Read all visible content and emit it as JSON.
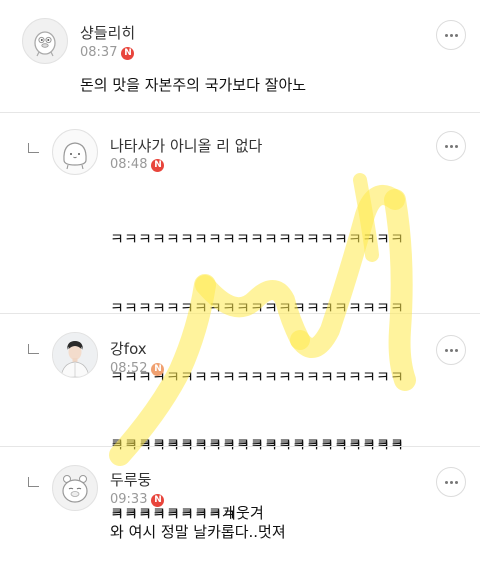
{
  "comments": [
    {
      "author": "샹들리히",
      "time": "08:37",
      "badge": "N",
      "badge_style": "red",
      "avatar_icon": "duck-character-icon",
      "is_reply": false,
      "text": "돈의 맛을 자본주의 국가보다 잘아노"
    },
    {
      "author": "나타샤가 아니올 리 없다",
      "time": "08:48",
      "badge": "N",
      "badge_style": "red",
      "avatar_icon": "blob-character-icon",
      "is_reply": true,
      "lines": [
        "ㅋㅋㅋㅋㅋㅋㅋㅋㅋㅋㅋㅋㅋㅋㅋㅋㅋㅋㅋㅋㅋ",
        "ㅋㅋㅋㅋㅋㅋㅋㅋㅋㅋㅋㅋㅋㅋㅋㅋㅋㅋㅋㅋㅋ",
        "ㅋㅋㅋㅋㅋㅋㅋㅋㅋㅋㅋㅋㅋㅋㅋㅋㅋㅋㅋㅋㅋ",
        "ㅋㅋㅋㅋㅋㅋㅋㅋㅋㅋㅋㅋㅋㅋㅋㅋㅋㅋㅋㅋㅋ",
        "ㅋㅋㅋㅋㅋㅋㅋㅋㅋ"
      ]
    },
    {
      "author": "강fox",
      "time": "08:52",
      "badge": "N",
      "badge_style": "orange",
      "avatar_icon": "person-portrait-icon",
      "is_reply": true,
      "lines": [
        "ㅋㅋㅋㅋㅋㅋㅋㅋㅋㅋㅋㅋㅋㅋㅋㅋㅋㅋㅋㅋㅋ",
        "ㅋㅋㅋㅋㅋㅋㅋㅋ개웃겨"
      ]
    },
    {
      "author": "두루둥",
      "time": "09:33",
      "badge": "N",
      "badge_style": "red",
      "avatar_icon": "bear-character-icon",
      "is_reply": true,
      "text": "와 여시 정말 날카롭다..멋져"
    }
  ],
  "colors": {
    "badge_red": "#e8453c",
    "watermark_yellow": "#ffe94d"
  }
}
